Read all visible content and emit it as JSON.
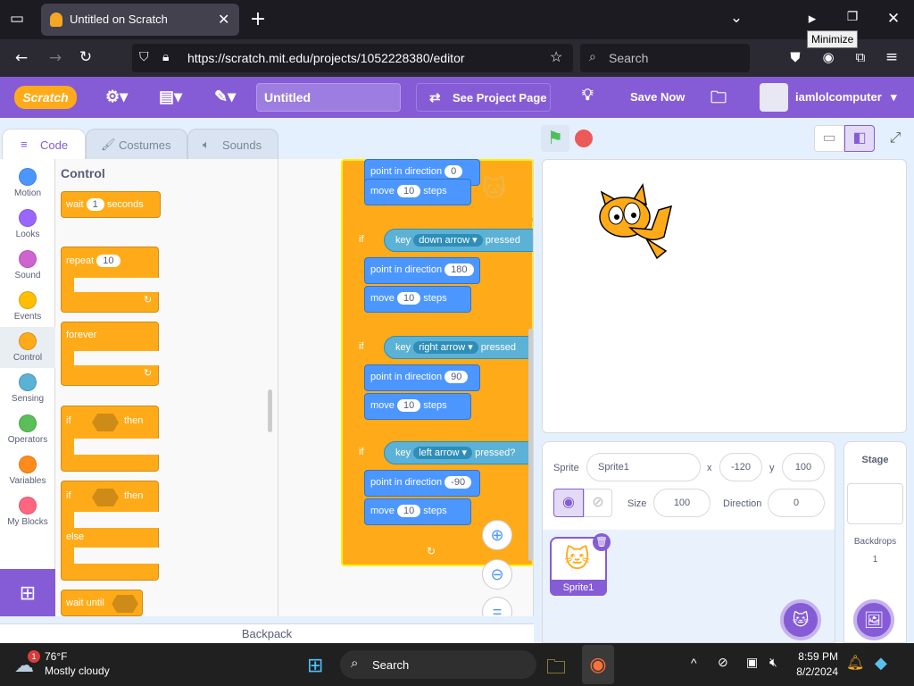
{
  "browser": {
    "tab_title": "Untitled on Scratch",
    "url": "https://scratch.mit.edu/projects/1052228380/editor",
    "search_placeholder": "Search",
    "tooltip": "Minimize"
  },
  "menubar": {
    "logo": "Scratch",
    "project_title": "Untitled",
    "see_project_page": "See Project Page",
    "save_now": "Save Now",
    "username": "iamlolcomputer"
  },
  "tabs": {
    "code": "Code",
    "costumes": "Costumes",
    "sounds": "Sounds"
  },
  "categories": [
    {
      "label": "Motion",
      "color": "#4c97ff"
    },
    {
      "label": "Looks",
      "color": "#9966ff"
    },
    {
      "label": "Sound",
      "color": "#cf63cf"
    },
    {
      "label": "Events",
      "color": "#ffbf00"
    },
    {
      "label": "Control",
      "color": "#ffab19"
    },
    {
      "label": "Sensing",
      "color": "#5cb1d6"
    },
    {
      "label": "Operators",
      "color": "#59c059"
    },
    {
      "label": "Variables",
      "color": "#ff8c1a"
    },
    {
      "label": "My Blocks",
      "color": "#ff6680"
    }
  ],
  "palette": {
    "heading": "Control",
    "wait": "wait",
    "wait_value": "1",
    "seconds": "seconds",
    "repeat": "repeat",
    "repeat_value": "10",
    "forever": "forever",
    "if": "if",
    "then": "then",
    "else": "else",
    "wait_until": "wait until"
  },
  "script": {
    "blocks": [
      {
        "kind": "motion",
        "text": "point in direction",
        "value": "0"
      },
      {
        "kind": "motion",
        "text": "move",
        "value": "10",
        "suffix": "steps"
      },
      {
        "kind": "if",
        "key": "key",
        "option": "down arrow",
        "tail": "pressed"
      },
      {
        "kind": "motion",
        "text": "point in direction",
        "value": "180"
      },
      {
        "kind": "motion",
        "text": "move",
        "value": "10",
        "suffix": "steps"
      },
      {
        "kind": "if",
        "key": "key",
        "option": "right arrow",
        "tail": "pressed"
      },
      {
        "kind": "motion",
        "text": "point in direction",
        "value": "90"
      },
      {
        "kind": "motion",
        "text": "move",
        "value": "10",
        "suffix": "steps"
      },
      {
        "kind": "if",
        "key": "key",
        "option": "left arrow",
        "tail": "pressed?"
      },
      {
        "kind": "motion",
        "text": "point in direction",
        "value": "-90"
      },
      {
        "kind": "motion",
        "text": "move",
        "value": "10",
        "suffix": "steps"
      }
    ],
    "if_label": "if"
  },
  "sprite_info": {
    "sprite_label": "Sprite",
    "sprite_name": "Sprite1",
    "x_label": "x",
    "x_value": "-120",
    "y_label": "y",
    "y_value": "100",
    "size_label": "Size",
    "size_value": "100",
    "direction_label": "Direction",
    "direction_value": "0",
    "thumb_name": "Sprite1"
  },
  "stage_pane": {
    "title": "Stage",
    "backdrops_label": "Backdrops",
    "backdrops_count": "1"
  },
  "backpack": "Backpack",
  "taskbar": {
    "temp": "76°F",
    "weather": "Mostly cloudy",
    "badge": "1",
    "search": "Search",
    "time": "8:59 PM",
    "date": "8/2/2024"
  }
}
